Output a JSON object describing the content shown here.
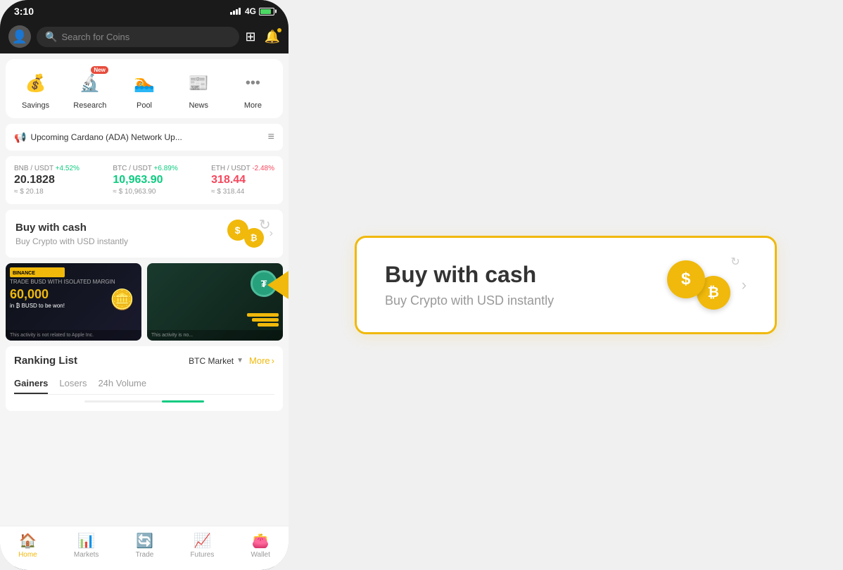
{
  "status_bar": {
    "time": "3:10",
    "network": "4G"
  },
  "header": {
    "search_placeholder": "Search for Coins"
  },
  "quick_menu": {
    "items": [
      {
        "id": "savings",
        "label": "Savings",
        "icon": "💰",
        "badge": null
      },
      {
        "id": "research",
        "label": "Research",
        "icon": "🔬",
        "badge": "New"
      },
      {
        "id": "pool",
        "label": "Pool",
        "icon": "🏊",
        "badge": null
      },
      {
        "id": "news",
        "label": "News",
        "icon": "📰",
        "badge": null
      },
      {
        "id": "more",
        "label": "More",
        "icon": "⋯",
        "badge": null
      }
    ]
  },
  "announcement": {
    "text": "Upcoming Cardano (ADA) Network Up..."
  },
  "price_ticker": {
    "pairs": [
      {
        "pair": "BNB / USDT",
        "change": "+4.52%",
        "direction": "up",
        "value": "20.1828",
        "usd": "≈ $ 20.18"
      },
      {
        "pair": "BTC / USDT",
        "change": "+6.89%",
        "direction": "up",
        "value": "10,963.90",
        "usd": "≈ $ 10,963.90"
      },
      {
        "pair": "ETH / USDT",
        "change": "-2.48%",
        "direction": "down",
        "value": "318.44",
        "usd": "≈ $ 318.44"
      }
    ]
  },
  "buy_cash": {
    "title": "Buy with cash",
    "subtitle": "Buy Crypto with USD instantly"
  },
  "ranking": {
    "title": "Ranking List",
    "market": "BTC Market",
    "more_label": "More",
    "tabs": [
      "Gainers",
      "Losers",
      "24h Volume"
    ]
  },
  "bottom_nav": {
    "items": [
      {
        "id": "home",
        "label": "Home",
        "icon": "🏠",
        "active": true
      },
      {
        "id": "markets",
        "label": "Markets",
        "icon": "📊",
        "active": false
      },
      {
        "id": "trade",
        "label": "Trade",
        "icon": "🔄",
        "active": false
      },
      {
        "id": "futures",
        "label": "Futures",
        "icon": "📈",
        "active": false
      },
      {
        "id": "wallet",
        "label": "Wallet",
        "icon": "👛",
        "active": false
      }
    ]
  },
  "expanded_card": {
    "title": "Buy with cash",
    "subtitle": "Buy Crypto with USD instantly"
  }
}
